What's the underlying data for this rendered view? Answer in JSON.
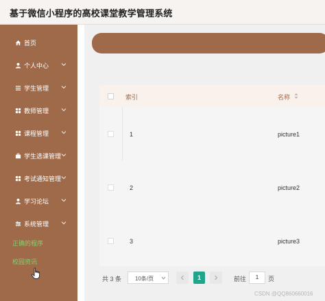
{
  "header": {
    "title": "基于微信小程序的高校课堂教学管理系统"
  },
  "sidebar": {
    "items": [
      {
        "label": "首页",
        "icon": "home-icon",
        "has_children": false
      },
      {
        "label": "个人中心",
        "icon": "user-icon",
        "has_children": true
      },
      {
        "label": "学生管理",
        "icon": "list-icon",
        "has_children": true
      },
      {
        "label": "教师管理",
        "icon": "grid-icon",
        "has_children": true
      },
      {
        "label": "课程管理",
        "icon": "grid-icon",
        "has_children": true
      },
      {
        "label": "学生选课管理",
        "icon": "briefcase-icon",
        "has_children": true
      },
      {
        "label": "考试通知管理",
        "icon": "grid-icon",
        "has_children": true
      },
      {
        "label": "学习论坛",
        "icon": "user-icon",
        "has_children": true
      },
      {
        "label": "系统管理",
        "icon": "settings-icon",
        "has_children": true
      }
    ],
    "sub_items": [
      {
        "label": "正确的程序"
      },
      {
        "label": "校园资讯"
      }
    ]
  },
  "table": {
    "columns": [
      "索引",
      "名称"
    ],
    "rows": [
      {
        "index": "1",
        "name": "picture1"
      },
      {
        "index": "2",
        "name": "picture2"
      },
      {
        "index": "3",
        "name": "picture3"
      }
    ]
  },
  "pagination": {
    "total": "共 3 条",
    "page_size": "10条/页",
    "current_page": "1",
    "goto_label": "前往",
    "goto_value": "1",
    "page_suffix": "页"
  },
  "watermark": "CSDN @QQ860660016",
  "colors": {
    "primary": "#9e6a4a",
    "accent": "#20a58a",
    "submenu_text": "#7fd46b"
  }
}
